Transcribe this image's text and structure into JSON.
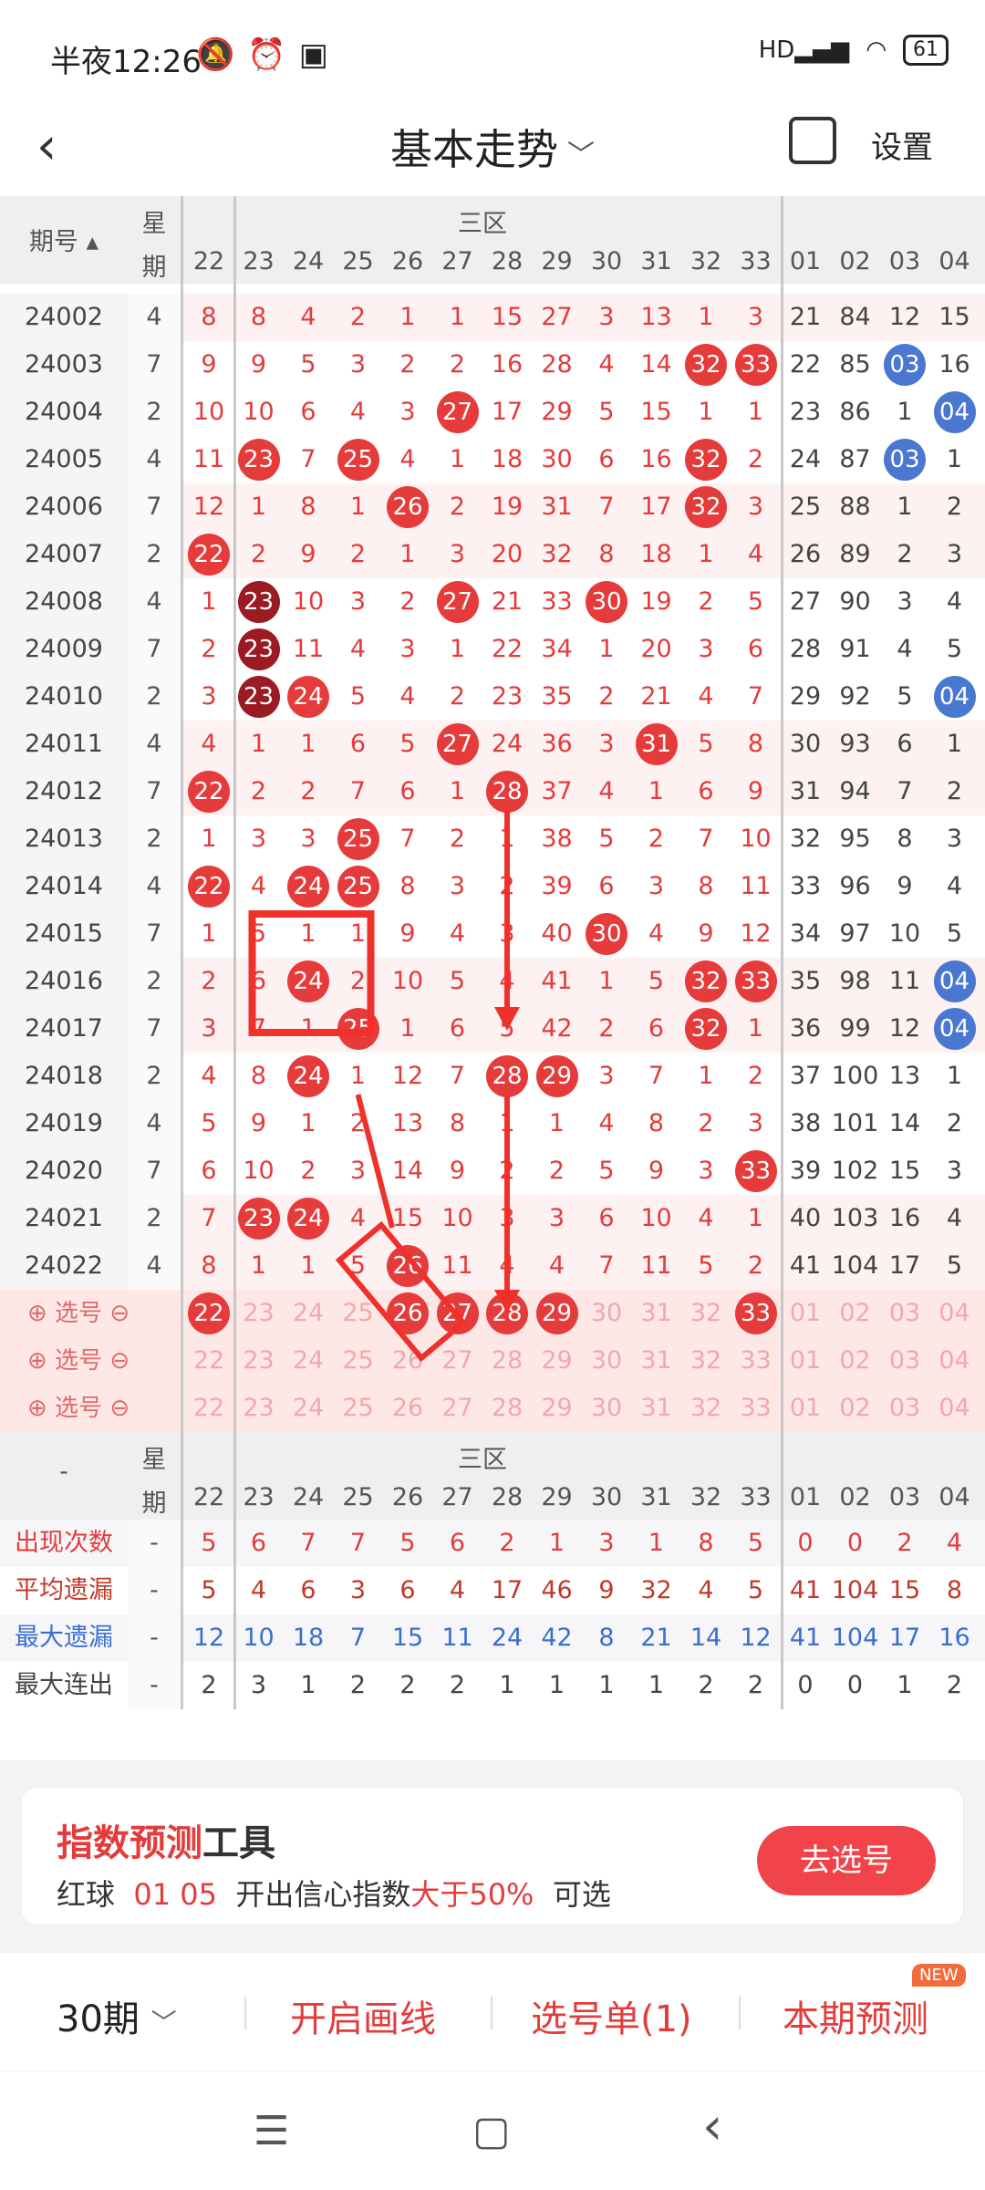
{
  "status": {
    "time": "半夜12:26",
    "battery": "61",
    "net": "HD"
  },
  "header": {
    "title": "基本走势",
    "settings": "设置"
  },
  "table_header": {
    "issue": "期号",
    "week_top": "星",
    "week_bottom": "期",
    "zone": "三区",
    "cols": [
      "22",
      "23",
      "24",
      "25",
      "26",
      "27",
      "28",
      "29",
      "30",
      "31",
      "32",
      "33",
      "01",
      "02",
      "03",
      "04"
    ]
  },
  "rows": [
    {
      "issue": "24002",
      "wk": "4",
      "vals": [
        "8",
        "8",
        "4",
        "2",
        "1",
        "1",
        "15",
        "27",
        "3",
        "13",
        "1",
        "3",
        "21",
        "84",
        "12",
        "15"
      ],
      "balls": []
    },
    {
      "issue": "24003",
      "wk": "7",
      "vals": [
        "9",
        "9",
        "5",
        "3",
        "2",
        "2",
        "16",
        "28",
        "4",
        "14",
        "32",
        "33",
        "22",
        "85",
        "03",
        "16"
      ],
      "balls": [
        [
          10,
          "red"
        ],
        [
          11,
          "red"
        ],
        [
          14,
          "blue"
        ]
      ]
    },
    {
      "issue": "24004",
      "wk": "2",
      "vals": [
        "10",
        "10",
        "6",
        "4",
        "3",
        "27",
        "17",
        "29",
        "5",
        "15",
        "1",
        "1",
        "23",
        "86",
        "1",
        "04"
      ],
      "balls": [
        [
          5,
          "red"
        ],
        [
          15,
          "blue"
        ]
      ]
    },
    {
      "issue": "24005",
      "wk": "4",
      "vals": [
        "11",
        "23",
        "7",
        "25",
        "4",
        "1",
        "18",
        "30",
        "6",
        "16",
        "32",
        "2",
        "24",
        "87",
        "03",
        "1"
      ],
      "balls": [
        [
          1,
          "red"
        ],
        [
          3,
          "red"
        ],
        [
          10,
          "red"
        ],
        [
          14,
          "blue"
        ]
      ]
    },
    {
      "issue": "24006",
      "wk": "7",
      "vals": [
        "12",
        "1",
        "8",
        "1",
        "26",
        "2",
        "19",
        "31",
        "7",
        "17",
        "32",
        "3",
        "25",
        "88",
        "1",
        "2"
      ],
      "balls": [
        [
          4,
          "red"
        ],
        [
          10,
          "red"
        ]
      ]
    },
    {
      "issue": "24007",
      "wk": "2",
      "vals": [
        "22",
        "2",
        "9",
        "2",
        "1",
        "3",
        "20",
        "32",
        "8",
        "18",
        "1",
        "4",
        "26",
        "89",
        "2",
        "3"
      ],
      "balls": [
        [
          0,
          "red"
        ]
      ]
    },
    {
      "issue": "24008",
      "wk": "4",
      "vals": [
        "1",
        "23",
        "10",
        "3",
        "2",
        "27",
        "21",
        "33",
        "30",
        "19",
        "2",
        "5",
        "27",
        "90",
        "3",
        "4"
      ],
      "balls": [
        [
          1,
          "dark"
        ],
        [
          5,
          "red"
        ],
        [
          8,
          "red"
        ]
      ]
    },
    {
      "issue": "24009",
      "wk": "7",
      "vals": [
        "2",
        "23",
        "11",
        "4",
        "3",
        "1",
        "22",
        "34",
        "1",
        "20",
        "3",
        "6",
        "28",
        "91",
        "4",
        "5"
      ],
      "balls": [
        [
          1,
          "dark"
        ]
      ]
    },
    {
      "issue": "24010",
      "wk": "2",
      "vals": [
        "3",
        "23",
        "24",
        "5",
        "4",
        "2",
        "23",
        "35",
        "2",
        "21",
        "4",
        "7",
        "29",
        "92",
        "5",
        "04"
      ],
      "balls": [
        [
          1,
          "dark"
        ],
        [
          2,
          "red"
        ],
        [
          15,
          "blue"
        ]
      ]
    },
    {
      "issue": "24011",
      "wk": "4",
      "vals": [
        "4",
        "1",
        "1",
        "6",
        "5",
        "27",
        "24",
        "36",
        "3",
        "31",
        "5",
        "8",
        "30",
        "93",
        "6",
        "1"
      ],
      "balls": [
        [
          5,
          "red"
        ],
        [
          9,
          "red"
        ]
      ]
    },
    {
      "issue": "24012",
      "wk": "7",
      "vals": [
        "22",
        "2",
        "2",
        "7",
        "6",
        "1",
        "28",
        "37",
        "4",
        "1",
        "6",
        "9",
        "31",
        "94",
        "7",
        "2"
      ],
      "balls": [
        [
          0,
          "red"
        ],
        [
          6,
          "red"
        ]
      ]
    },
    {
      "issue": "24013",
      "wk": "2",
      "vals": [
        "1",
        "3",
        "3",
        "25",
        "7",
        "2",
        "1",
        "38",
        "5",
        "2",
        "7",
        "10",
        "32",
        "95",
        "8",
        "3"
      ],
      "balls": [
        [
          3,
          "red"
        ]
      ]
    },
    {
      "issue": "24014",
      "wk": "4",
      "vals": [
        "22",
        "4",
        "24",
        "25",
        "8",
        "3",
        "2",
        "39",
        "6",
        "3",
        "8",
        "11",
        "33",
        "96",
        "9",
        "4"
      ],
      "balls": [
        [
          0,
          "red"
        ],
        [
          2,
          "red"
        ],
        [
          3,
          "red"
        ]
      ]
    },
    {
      "issue": "24015",
      "wk": "7",
      "vals": [
        "1",
        "5",
        "1",
        "1",
        "9",
        "4",
        "3",
        "40",
        "30",
        "4",
        "9",
        "12",
        "34",
        "97",
        "10",
        "5"
      ],
      "balls": [
        [
          8,
          "red"
        ]
      ]
    },
    {
      "issue": "24016",
      "wk": "2",
      "vals": [
        "2",
        "6",
        "24",
        "2",
        "10",
        "5",
        "4",
        "41",
        "1",
        "5",
        "32",
        "33",
        "35",
        "98",
        "11",
        "04"
      ],
      "balls": [
        [
          2,
          "red"
        ],
        [
          10,
          "red"
        ],
        [
          11,
          "red"
        ],
        [
          15,
          "blue"
        ]
      ]
    },
    {
      "issue": "24017",
      "wk": "7",
      "vals": [
        "3",
        "7",
        "1",
        "25",
        "1",
        "6",
        "5",
        "42",
        "2",
        "6",
        "32",
        "1",
        "36",
        "99",
        "12",
        "04"
      ],
      "balls": [
        [
          3,
          "red"
        ],
        [
          10,
          "red"
        ],
        [
          15,
          "blue"
        ]
      ]
    },
    {
      "issue": "24018",
      "wk": "2",
      "vals": [
        "4",
        "8",
        "24",
        "1",
        "12",
        "7",
        "28",
        "29",
        "3",
        "7",
        "1",
        "2",
        "37",
        "100",
        "13",
        "1"
      ],
      "balls": [
        [
          2,
          "red"
        ],
        [
          6,
          "red"
        ],
        [
          7,
          "red"
        ]
      ]
    },
    {
      "issue": "24019",
      "wk": "4",
      "vals": [
        "5",
        "9",
        "1",
        "2",
        "13",
        "8",
        "1",
        "1",
        "4",
        "8",
        "2",
        "3",
        "38",
        "101",
        "14",
        "2"
      ],
      "balls": []
    },
    {
      "issue": "24020",
      "wk": "7",
      "vals": [
        "6",
        "10",
        "2",
        "3",
        "14",
        "9",
        "2",
        "2",
        "5",
        "9",
        "3",
        "33",
        "39",
        "102",
        "15",
        "3"
      ],
      "balls": [
        [
          11,
          "red"
        ]
      ]
    },
    {
      "issue": "24021",
      "wk": "2",
      "vals": [
        "7",
        "23",
        "24",
        "4",
        "15",
        "10",
        "3",
        "3",
        "6",
        "10",
        "4",
        "1",
        "40",
        "103",
        "16",
        "4"
      ],
      "balls": [
        [
          1,
          "red"
        ],
        [
          2,
          "red"
        ]
      ]
    },
    {
      "issue": "24022",
      "wk": "4",
      "vals": [
        "8",
        "1",
        "1",
        "5",
        "26",
        "11",
        "4",
        "4",
        "7",
        "11",
        "5",
        "2",
        "41",
        "104",
        "17",
        "5"
      ],
      "balls": [
        [
          4,
          "red"
        ]
      ]
    }
  ],
  "pick_rows": [
    {
      "label": "选号",
      "vals": [
        "22",
        "23",
        "24",
        "25",
        "26",
        "27",
        "28",
        "29",
        "30",
        "31",
        "32",
        "33",
        "01",
        "02",
        "03",
        "04"
      ],
      "balls": [
        0,
        4,
        5,
        6,
        7,
        11
      ]
    },
    {
      "label": "选号",
      "vals": [
        "22",
        "23",
        "24",
        "25",
        "26",
        "27",
        "28",
        "29",
        "30",
        "31",
        "32",
        "33",
        "01",
        "02",
        "03",
        "04"
      ],
      "balls": []
    },
    {
      "label": "选号",
      "vals": [
        "22",
        "23",
        "24",
        "25",
        "26",
        "27",
        "28",
        "29",
        "30",
        "31",
        "32",
        "33",
        "01",
        "02",
        "03",
        "04"
      ],
      "balls": []
    }
  ],
  "stats_header": {
    "dash": "-",
    "week_top": "星",
    "week_bottom": "期",
    "zone": "三区"
  },
  "stats": [
    {
      "label": "出现次数",
      "color": "#e23c3c",
      "wk": "-",
      "vals": [
        "5",
        "6",
        "7",
        "7",
        "5",
        "6",
        "2",
        "1",
        "3",
        "1",
        "8",
        "5",
        "0",
        "0",
        "2",
        "4"
      ]
    },
    {
      "label": "平均遗漏",
      "color": "#c0392b",
      "wk": "-",
      "vals": [
        "5",
        "4",
        "6",
        "3",
        "6",
        "4",
        "17",
        "46",
        "9",
        "32",
        "4",
        "5",
        "41",
        "104",
        "15",
        "8"
      ]
    },
    {
      "label": "最大遗漏",
      "color": "#3a6fd0",
      "wk": "-",
      "vals": [
        "12",
        "10",
        "18",
        "7",
        "15",
        "11",
        "24",
        "42",
        "8",
        "21",
        "14",
        "12",
        "41",
        "104",
        "17",
        "16"
      ]
    },
    {
      "label": "最大连出",
      "color": "#444",
      "wk": "-",
      "vals": [
        "2",
        "3",
        "1",
        "2",
        "2",
        "2",
        "1",
        "1",
        "1",
        "1",
        "2",
        "2",
        "0",
        "0",
        "1",
        "2"
      ]
    }
  ],
  "card": {
    "title_red": "指数预测",
    "title_black": "工具",
    "line_a": "红球",
    "line_nums": "01 05",
    "line_b": "开出信心指数",
    "line_red": "大于50%",
    "line_c": "可选",
    "button": "去选号"
  },
  "toolbar": {
    "period": "30期",
    "draw": "开启画线",
    "picklist": "选号单(1)",
    "predict": "本期预测",
    "badge": "NEW"
  },
  "nav": {
    "menu": "☰",
    "home": "▢",
    "back": "‹"
  }
}
